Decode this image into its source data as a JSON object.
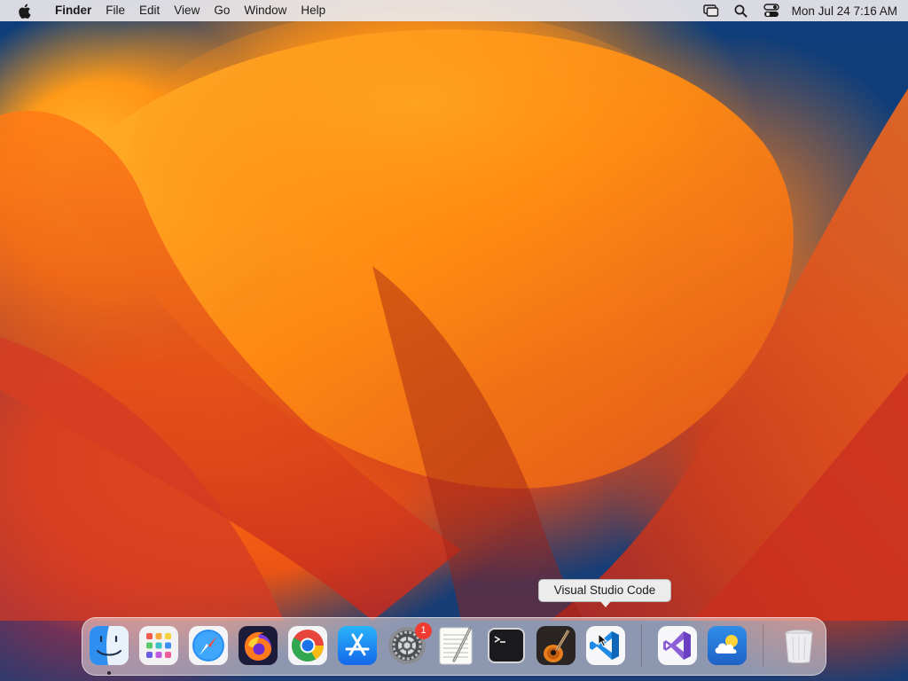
{
  "menubar": {
    "apple_icon": "apple-logo-icon",
    "app_name": "Finder",
    "menus": [
      "File",
      "Edit",
      "View",
      "Go",
      "Window",
      "Help"
    ],
    "status_icons": [
      "screen-mirroring-icon",
      "spotlight-search-icon",
      "control-center-icon"
    ],
    "clock": "Mon Jul 24  7:16 AM"
  },
  "tooltip": {
    "text": "Visual Studio Code"
  },
  "dock": {
    "apps": [
      {
        "name": "Finder",
        "icon": "finder-icon",
        "running": true
      },
      {
        "name": "Launchpad",
        "icon": "launchpad-icon",
        "running": false
      },
      {
        "name": "Safari",
        "icon": "safari-icon",
        "running": false
      },
      {
        "name": "Firefox",
        "icon": "firefox-icon",
        "running": false
      },
      {
        "name": "Google Chrome",
        "icon": "chrome-icon",
        "running": false
      },
      {
        "name": "App Store",
        "icon": "app-store-icon",
        "running": false
      },
      {
        "name": "System Settings",
        "icon": "system-settings-icon",
        "running": false,
        "badge": "1"
      },
      {
        "name": "TextEdit",
        "icon": "textedit-icon",
        "running": false
      },
      {
        "name": "Terminal",
        "icon": "terminal-icon",
        "running": false
      },
      {
        "name": "GarageBand",
        "icon": "garageband-icon",
        "running": false
      },
      {
        "name": "Visual Studio Code",
        "icon": "vscode-icon",
        "running": false,
        "hovered": true
      }
    ],
    "recent_apps": [
      {
        "name": "Visual Studio",
        "icon": "visual-studio-icon"
      },
      {
        "name": "Weather",
        "icon": "weather-icon"
      }
    ],
    "trash": {
      "name": "Trash",
      "icon": "trash-icon"
    }
  },
  "colors": {
    "menubar_bg": "#ece8ea",
    "badge_red": "#f03b30",
    "vscode_blue": "#1e8ae6",
    "visual_studio_purple": "#8b5fd6"
  }
}
